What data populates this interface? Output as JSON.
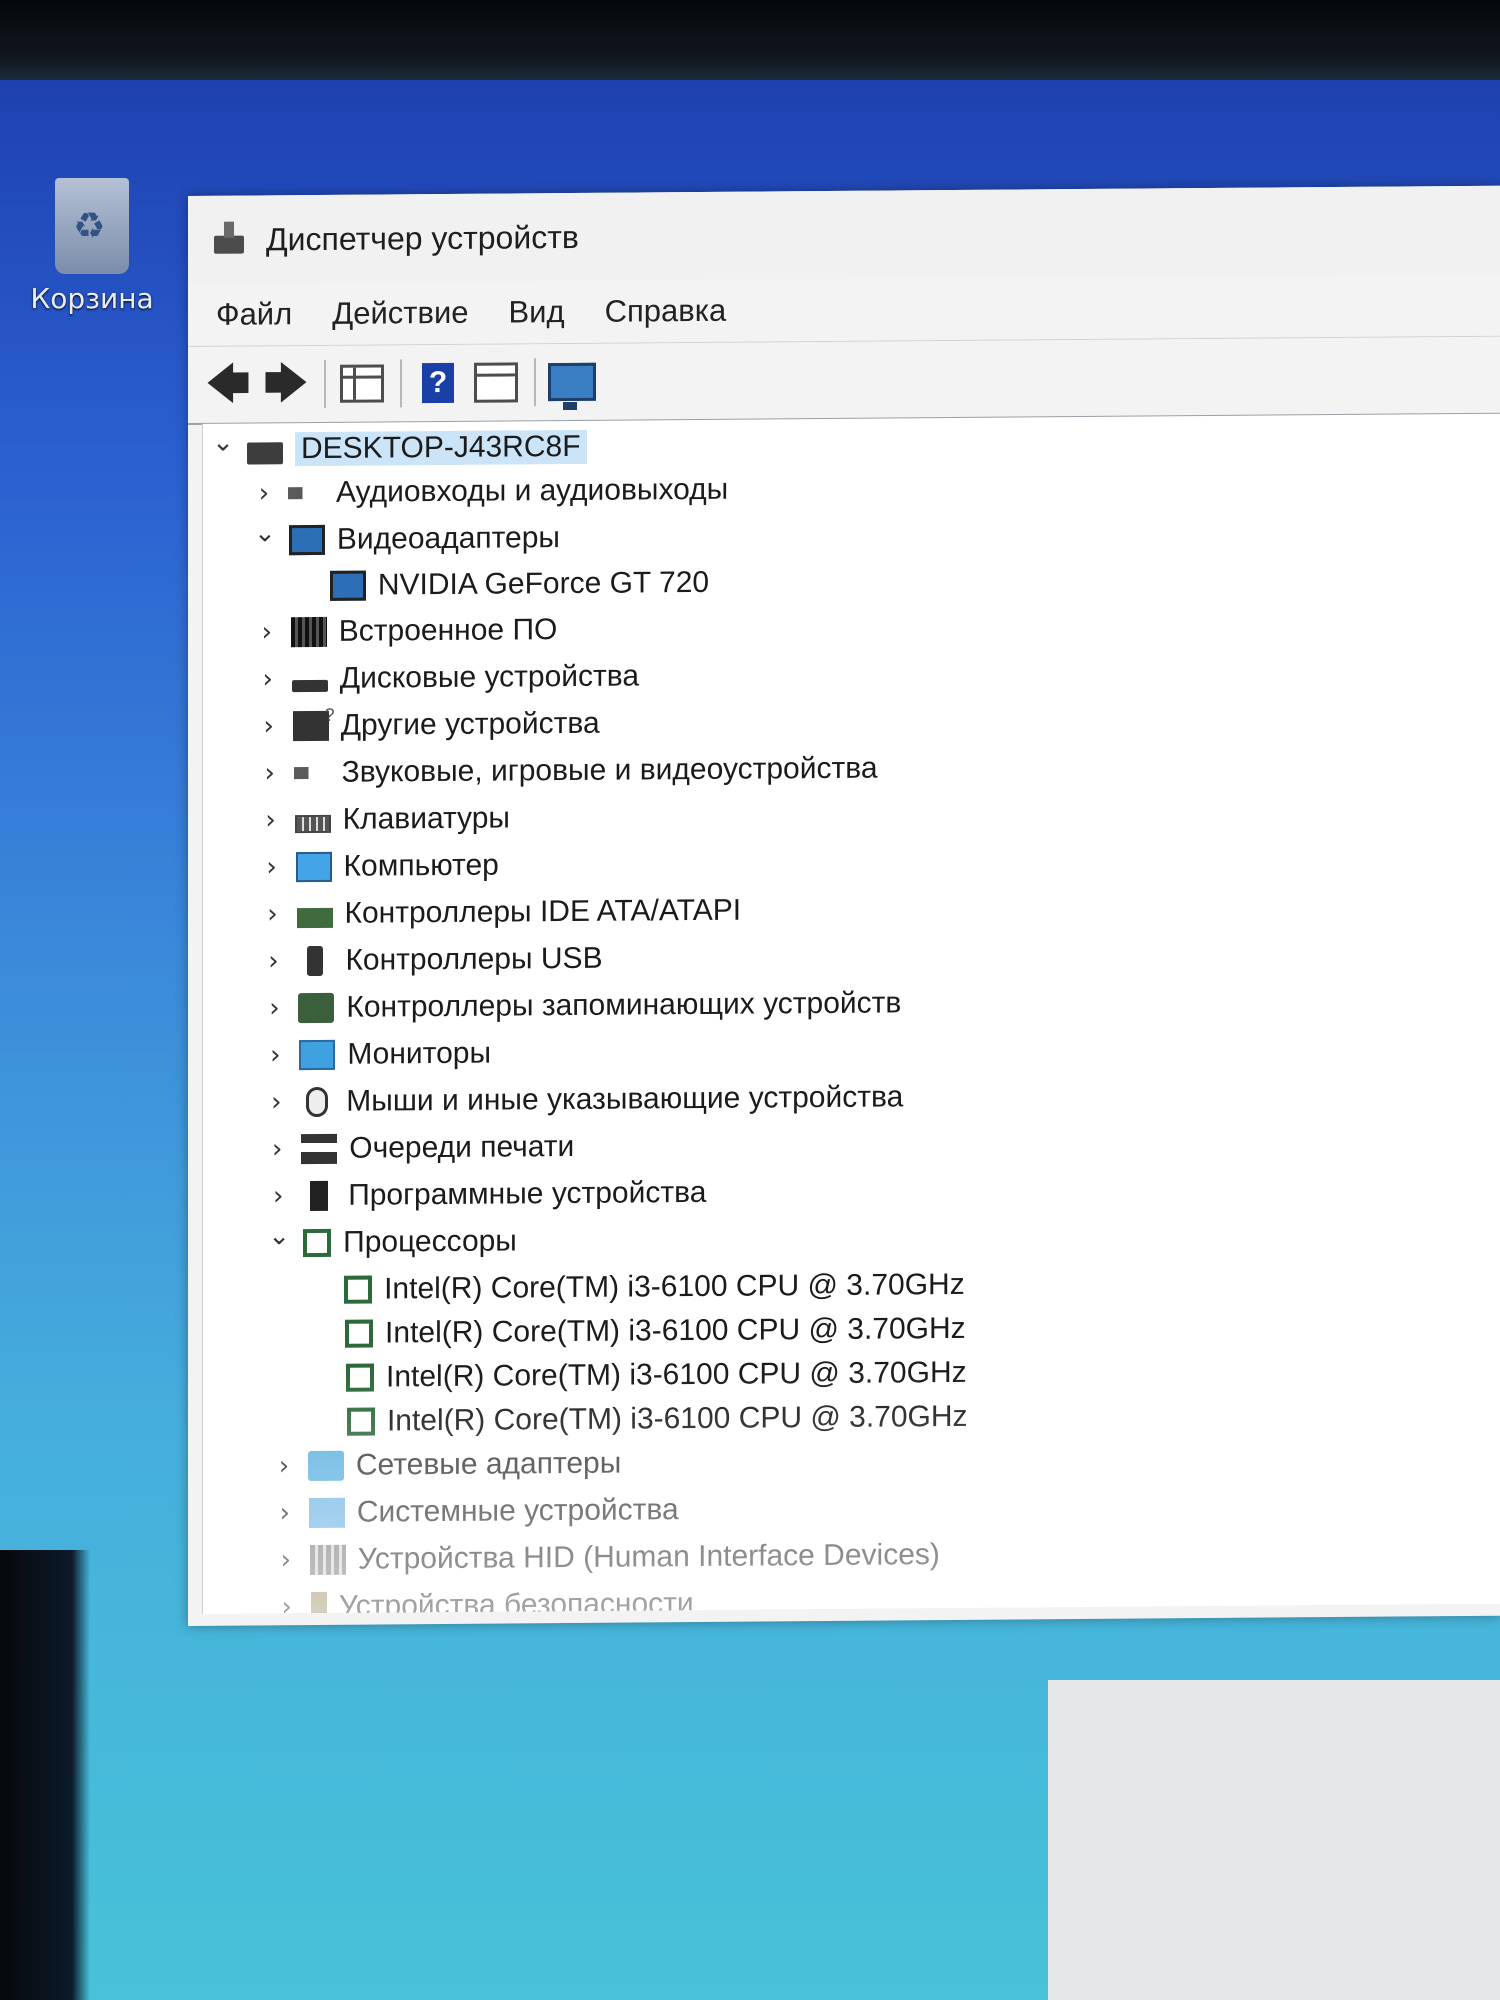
{
  "desktop": {
    "recycle_bin_label": "Корзина"
  },
  "window": {
    "title": "Диспетчер устройств",
    "menu": [
      "Файл",
      "Действие",
      "Вид",
      "Справка"
    ],
    "toolbar": {
      "back": "back-arrow-icon",
      "forward": "forward-arrow-icon",
      "show_hide": "console-tree-icon",
      "help": "help-icon",
      "properties": "properties-icon",
      "scan": "scan-hardware-icon"
    }
  },
  "tree": {
    "root": "DESKTOP-J43RC8F",
    "items": [
      {
        "label": "Аудиовходы и аудиовыходы",
        "expanded": false,
        "icon": "speaker-icon"
      },
      {
        "label": "Видеоадаптеры",
        "expanded": true,
        "icon": "display-adapter-icon",
        "children": [
          "NVIDIA GeForce GT 720"
        ]
      },
      {
        "label": "Встроенное ПО",
        "expanded": false,
        "icon": "firmware-icon"
      },
      {
        "label": "Дисковые устройства",
        "expanded": false,
        "icon": "disk-drive-icon"
      },
      {
        "label": "Другие устройства",
        "expanded": false,
        "icon": "other-devices-icon"
      },
      {
        "label": "Звуковые, игровые и видеоустройства",
        "expanded": false,
        "icon": "sound-icon"
      },
      {
        "label": "Клавиатуры",
        "expanded": false,
        "icon": "keyboard-icon"
      },
      {
        "label": "Компьютер",
        "expanded": false,
        "icon": "computer-icon"
      },
      {
        "label": "Контроллеры IDE ATA/ATAPI",
        "expanded": false,
        "icon": "ide-controller-icon"
      },
      {
        "label": "Контроллеры USB",
        "expanded": false,
        "icon": "usb-icon"
      },
      {
        "label": "Контроллеры запоминающих устройств",
        "expanded": false,
        "icon": "storage-controller-icon"
      },
      {
        "label": "Мониторы",
        "expanded": false,
        "icon": "monitor-icon"
      },
      {
        "label": "Мыши и иные указывающие устройства",
        "expanded": false,
        "icon": "mouse-icon"
      },
      {
        "label": "Очереди печати",
        "expanded": false,
        "icon": "printer-icon"
      },
      {
        "label": "Программные устройства",
        "expanded": false,
        "icon": "software-device-icon"
      },
      {
        "label": "Процессоры",
        "expanded": true,
        "icon": "processor-icon",
        "children": [
          "Intel(R) Core(TM) i3-6100 CPU @ 3.70GHz",
          "Intel(R) Core(TM) i3-6100 CPU @ 3.70GHz",
          "Intel(R) Core(TM) i3-6100 CPU @ 3.70GHz",
          "Intel(R) Core(TM) i3-6100 CPU @ 3.70GHz"
        ]
      },
      {
        "label": "Сетевые адаптеры",
        "expanded": false,
        "icon": "network-adapter-icon"
      },
      {
        "label": "Системные устройства",
        "expanded": false,
        "icon": "system-devices-icon"
      },
      {
        "label": "Устройства HID (Human Interface Devices)",
        "expanded": false,
        "icon": "hid-icon"
      },
      {
        "label": "Устройства безопасности",
        "expanded": false,
        "icon": "security-device-icon"
      }
    ]
  }
}
